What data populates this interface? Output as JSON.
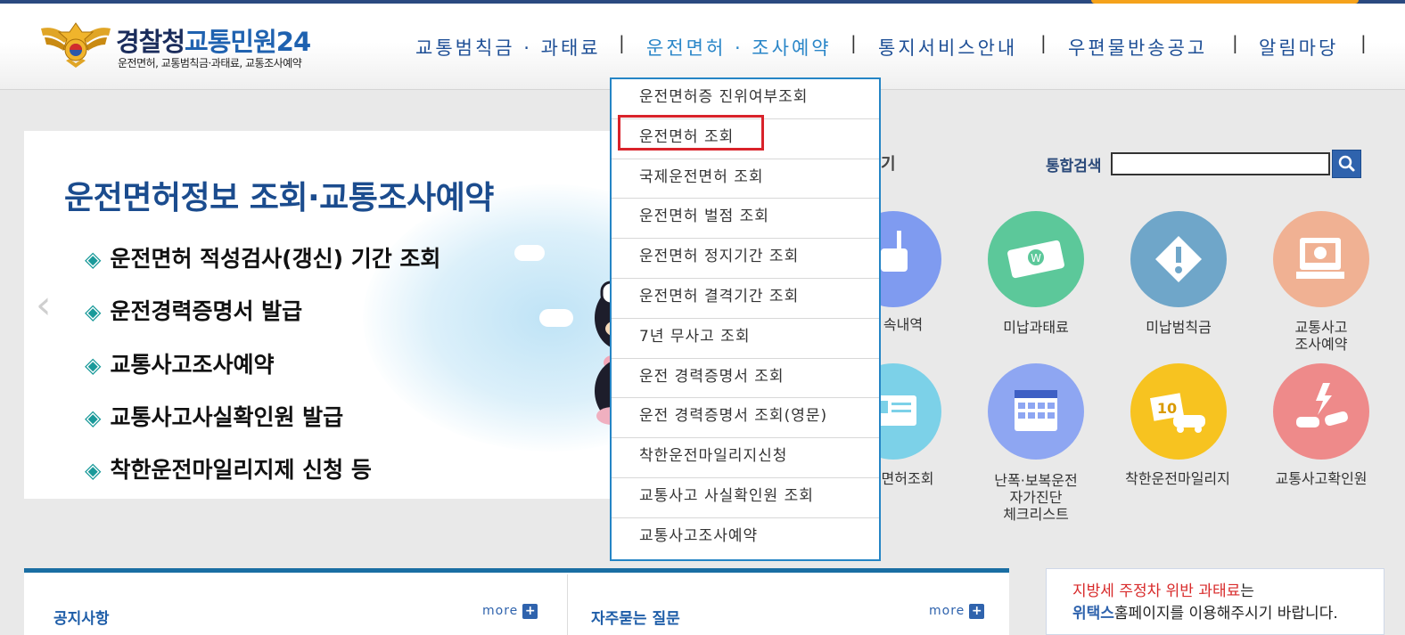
{
  "brand": {
    "title_main": "경찰청",
    "title_accent": "교통민원24",
    "subtitle": "운전면허, 교통범칙금·과태료, 교통조사예약"
  },
  "nav": {
    "items": [
      {
        "label": "교통범칙금 · 과태료"
      },
      {
        "label": "운전면허 · 조사예약"
      },
      {
        "label": "통지서비스안내"
      },
      {
        "label": "우편물반송공고"
      },
      {
        "label": "알림마당"
      }
    ],
    "separator": "|"
  },
  "dropdown": {
    "items": [
      {
        "label": "운전면허증 진위여부조회"
      },
      {
        "label": "운전면허 조회"
      },
      {
        "label": "국제운전면허 조회"
      },
      {
        "label": "운전면허 벌점 조회"
      },
      {
        "label": "운전면허 정지기간 조회"
      },
      {
        "label": "운전면허 결격기간 조회"
      },
      {
        "label": "7년 무사고 조회"
      },
      {
        "label": "운전 경력증명서 조회"
      },
      {
        "label": "운전 경력증명서 조회(영문)"
      },
      {
        "label": "착한운전마일리지신청"
      },
      {
        "label": "교통사고 사실확인원 조회"
      },
      {
        "label": "교통사고조사예약"
      }
    ],
    "highlighted_index": 1
  },
  "banner": {
    "title": "운전면허정보 조회·교통조사예약",
    "bullet_symbol": "◈",
    "bullets": [
      "운전면허 적성검사(갱신) 기간 조회",
      "운전경력증명서 발급",
      "교통사고조사예약",
      "교통사고사실확인원 발급",
      "착한운전마일리지제 신청 등"
    ],
    "prev_arrow": "‹"
  },
  "quick": {
    "title_tail": "기",
    "search_label": "통합검색",
    "search_value": "",
    "row1": [
      {
        "label": "속내역",
        "icon": "signal-icon",
        "color": "#7f9bf0"
      },
      {
        "label": "미납과태료",
        "icon": "money-icon",
        "color": "#5cc89a"
      },
      {
        "label": "미납범칙금",
        "icon": "warning-icon",
        "color": "#6fa6c9"
      },
      {
        "label": "교통사고\n조사예약",
        "icon": "monitor-icon",
        "color": "#f0b193"
      }
    ],
    "row2": [
      {
        "label": "면허조회",
        "icon": "id-card-icon",
        "color": "#7cd1e8"
      },
      {
        "label": "난폭·보복운전\n자가진단\n체크리스트",
        "icon": "calendar-icon",
        "color": "#8ea6f2"
      },
      {
        "label": "착한운전마일리지",
        "icon": "mileage-car-icon",
        "color": "#f7c320"
      },
      {
        "label": "교통사고확인원",
        "icon": "crash-icon",
        "color": "#ee8a8a"
      }
    ]
  },
  "notice": {
    "title": "공지사항",
    "more": "more"
  },
  "faq": {
    "title": "자주묻는 질문",
    "more": "more"
  },
  "promo": {
    "line1_red": "지방세 주정차 위반 과태료",
    "line1_rest": "는",
    "line2_blue": "위택스",
    "line2_rest": "홈페이지를 이용해주시기 바랍니다."
  },
  "colors": {
    "brand_navy": "#1b2d5c",
    "nav_blue": "#1e4f96",
    "active_blue": "#2a86c8",
    "highlight_red": "#d9222a"
  }
}
